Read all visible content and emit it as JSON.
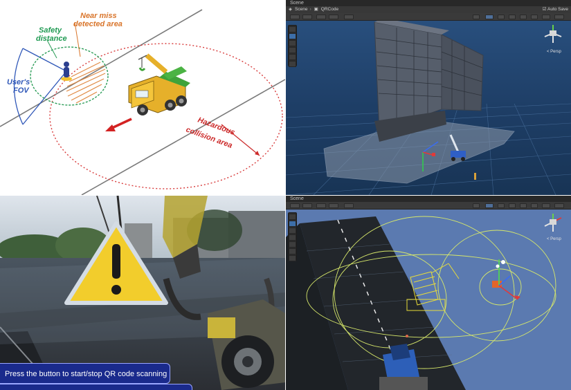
{
  "diagram": {
    "labels": {
      "near_miss": [
        "Near miss",
        "detected area"
      ],
      "safety": [
        "Safety",
        "distance"
      ],
      "fov": [
        "User's",
        "FOV"
      ],
      "hazard": [
        "Hazardous",
        "collision area"
      ]
    },
    "colors": {
      "near_miss": "#d9752b",
      "safety": "#1f9a52",
      "fov": "#2f57b8",
      "hazard": "#cc2a2a"
    }
  },
  "unity_top": {
    "window_title": "Scene",
    "tabs": [
      "Scene",
      "QRCode"
    ],
    "tab_icons": [
      "unity-icon",
      "cube-icon"
    ],
    "autosave": "Auto Save",
    "persp": "< Persp",
    "tools": [
      "hand-tool-icon",
      "move-tool-icon",
      "rotate-tool-icon",
      "scale-tool-icon",
      "rect-tool-icon",
      "transform-tool-icon"
    ]
  },
  "ar_view": {
    "message": "Press the button to start/stop QR code scanning",
    "warning_icon": "warning-triangle-icon"
  },
  "unity_bottom": {
    "window_title": "Scene",
    "persp": "< Persp",
    "tools": [
      "hand-tool-icon",
      "move-tool-icon",
      "rotate-tool-icon",
      "scale-tool-icon",
      "rect-tool-icon",
      "transform-tool-icon",
      "custom-tool-icon"
    ]
  }
}
